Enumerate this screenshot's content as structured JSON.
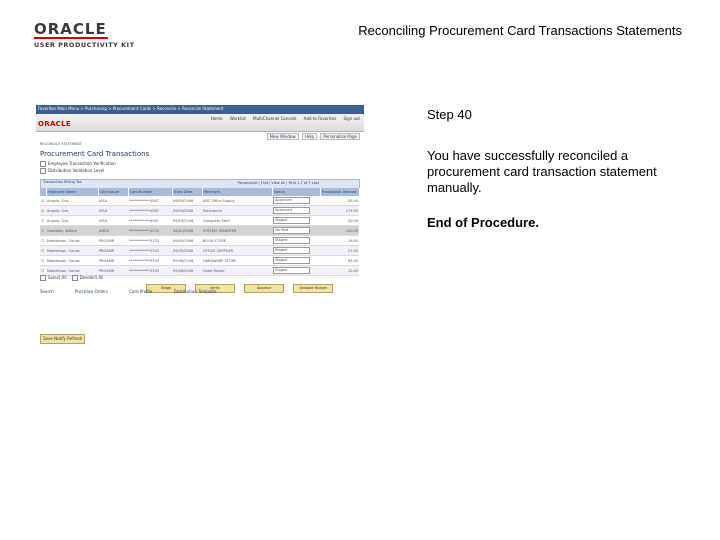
{
  "header": {
    "logo_word": "ORACLE",
    "logo_sub": "USER PRODUCTIVITY KIT",
    "document_title": "Reconciling Procurement Card Transactions Statements"
  },
  "panel": {
    "step": "Step 40",
    "message": "You have successfully reconciled a procurement card transaction statement manually.",
    "end": "End of Procedure."
  },
  "screenshot": {
    "breadcrumbs": "Favorites   Main Menu   >  Purchasing  >  Procurement Cards  >  Reconcile  >  Reconcile Statement",
    "brand": "ORACLE",
    "top_links": [
      "Home",
      "Worklist",
      "MultiChannel Console",
      "Add to Favorites",
      "Sign out"
    ],
    "sub_links": [
      "New Window",
      "Help",
      "Personalize Page"
    ],
    "crumb": "RECONCILE STATEMENT",
    "title": "Procurement Card Transactions",
    "options": [
      "Employee Transaction Verification",
      "Distribution Validation Level"
    ],
    "grid_tab": "Transaction   Billing   Tax",
    "grid_nav": "Personalize | Find | View All |  First  1-7 of 7  Last",
    "columns": [
      "Employee Name",
      "Card Issuer",
      "Card Number",
      "Trans Date",
      "Merchant",
      "Status",
      "Transaction Amount"
    ],
    "rows": [
      {
        "cb": "☑",
        "name": "Angulo, Gris",
        "issuer": "VISA",
        "card": "************4567",
        "date": "09/04/2006",
        "merchant": "ABC Office Supply",
        "status": "Approved",
        "amount": "55.00"
      },
      {
        "cb": "☑",
        "name": "Angulo, Gris",
        "issuer": "VISA",
        "card": "************4567",
        "date": "09/04/2006",
        "merchant": "Electronics",
        "status": "Approved",
        "amount": "179.50"
      },
      {
        "cb": "☐",
        "name": "Angulo, Gris",
        "issuer": "VISA",
        "card": "************4567",
        "date": "09/04/2006",
        "merchant": "Computer Stuff",
        "status": "Staged",
        "amount": "20.00"
      },
      {
        "cb": "☐",
        "name": "Gonzales, Wiliam",
        "issuer": "AMEX",
        "card": "************1234",
        "date": "08/01/2006",
        "merchant": "SYSTEM TRANSFER",
        "status": "Verified",
        "amount": "100.00"
      },
      {
        "cb": "☐",
        "name": "Madderson, Carlos",
        "issuer": "PROAMR",
        "card": "************3333",
        "date": "09/05/2006",
        "merchant": "BOOK STORE",
        "status": "Staged",
        "amount": "29.50"
      },
      {
        "cb": "☐",
        "name": "Madderson, Carlos",
        "issuer": "PROAMR",
        "card": "************3333",
        "date": "09/05/2006",
        "merchant": "OFFICE SUPPLIES",
        "status": "Staged",
        "amount": "27.45"
      },
      {
        "cb": "☐",
        "name": "Madderson, Carlos",
        "issuer": "PROAMR",
        "card": "************3333",
        "date": "09/06/2006",
        "merchant": "HARDWARE STORE",
        "status": "Staged",
        "amount": "65.00"
      },
      {
        "cb": "☐",
        "name": "Madderson, Carlos",
        "issuer": "PROAMR",
        "card": "************3333",
        "date": "09/06/2006",
        "merchant": "Hotel Rental",
        "status": "Staged",
        "amount": "12.00"
      }
    ],
    "bottom_options": [
      "Select All",
      "Deselect All"
    ],
    "buttons": [
      "Stage",
      "Verify",
      "Approve",
      "Validate Budget"
    ],
    "foot_links": [
      "Search",
      "Purchase Orders",
      "Card Profile",
      "Distribution Template"
    ],
    "savebar": "Save   Notify   Refresh"
  }
}
